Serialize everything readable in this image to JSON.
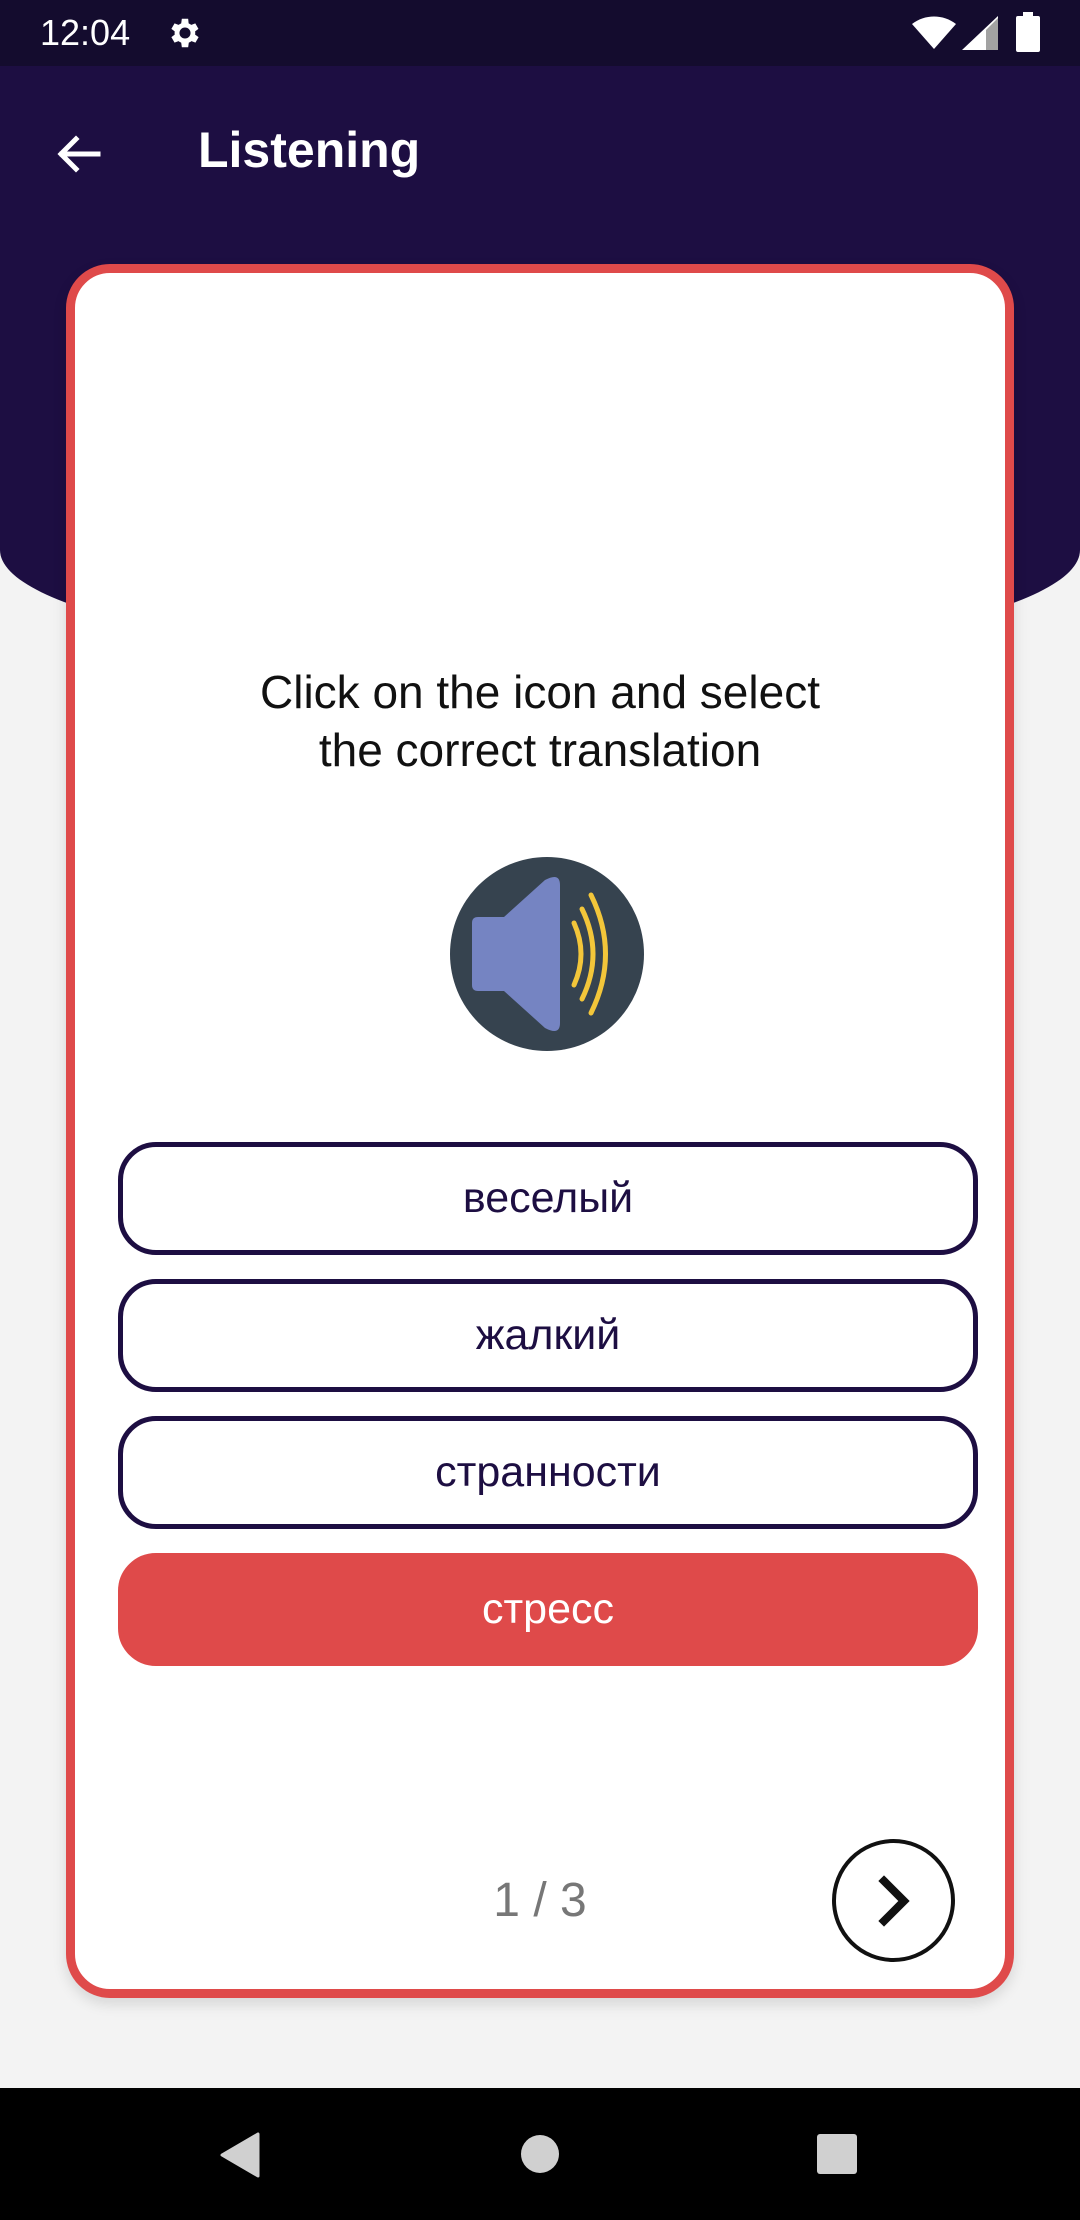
{
  "status_bar": {
    "time": "12:04",
    "icons": [
      "gear-icon",
      "wifi-icon",
      "signal-icon",
      "battery-icon"
    ]
  },
  "app_bar": {
    "title": "Listening",
    "back_icon": "arrow-left-icon"
  },
  "card": {
    "instruction": "Click on the icon and select\n the correct translation",
    "audio_icon": "speaker-icon",
    "options": [
      {
        "label": "веселый",
        "selected": false
      },
      {
        "label": "жалкий",
        "selected": false
      },
      {
        "label": "странности",
        "selected": false
      },
      {
        "label": "стресс",
        "selected": true
      }
    ],
    "progress": "1 / 3",
    "next_icon": "chevron-right-icon"
  },
  "nav_bar": {
    "icons": [
      "nav-back-icon",
      "nav-home-icon",
      "nav-recents-icon"
    ]
  },
  "colors": {
    "header": "#1d0e42",
    "accent": "#df4a4a",
    "speaker_bg": "#36434f",
    "speaker": "#7584c2",
    "sound_waves": "#f3c63a"
  }
}
